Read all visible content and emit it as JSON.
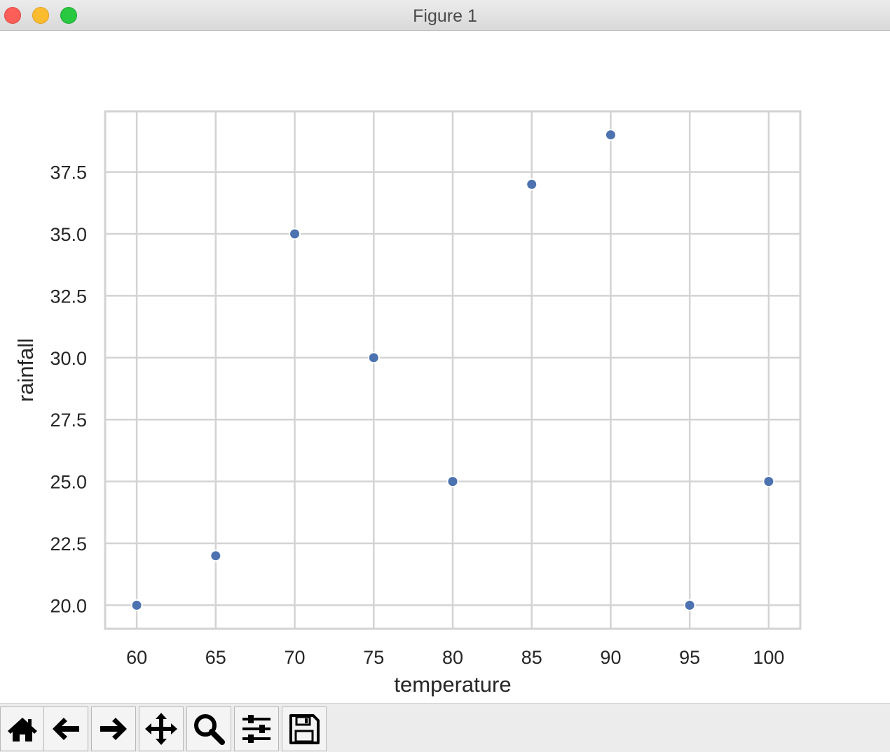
{
  "window": {
    "title": "Figure 1"
  },
  "chart_data": {
    "type": "scatter",
    "title": "",
    "xlabel": "temperature",
    "ylabel": "rainfall",
    "x": [
      60,
      65,
      70,
      75,
      80,
      85,
      90,
      95,
      100
    ],
    "y": [
      20,
      22,
      35,
      30,
      25,
      37,
      39,
      20,
      25
    ],
    "xlim": [
      58,
      102
    ],
    "ylim": [
      19.05,
      39.95
    ],
    "xticks": [
      60,
      65,
      70,
      75,
      80,
      85,
      90,
      95,
      100
    ],
    "yticks": [
      20.0,
      22.5,
      25.0,
      27.5,
      30.0,
      32.5,
      35.0,
      37.5
    ],
    "grid": true,
    "legend": false,
    "marker_color": "#4c72b0",
    "grid_color": "#d3d3d3"
  },
  "toolbar": {
    "buttons": [
      {
        "name": "home-button",
        "icon": "home-icon"
      },
      {
        "name": "back-button",
        "icon": "arrow-left-icon"
      },
      {
        "name": "forward-button",
        "icon": "arrow-right-icon"
      },
      {
        "name": "pan-button",
        "icon": "move-icon"
      },
      {
        "name": "zoom-button",
        "icon": "magnifier-icon"
      },
      {
        "name": "configure-subplots-button",
        "icon": "sliders-icon"
      },
      {
        "name": "save-button",
        "icon": "floppy-disk-icon"
      }
    ]
  }
}
